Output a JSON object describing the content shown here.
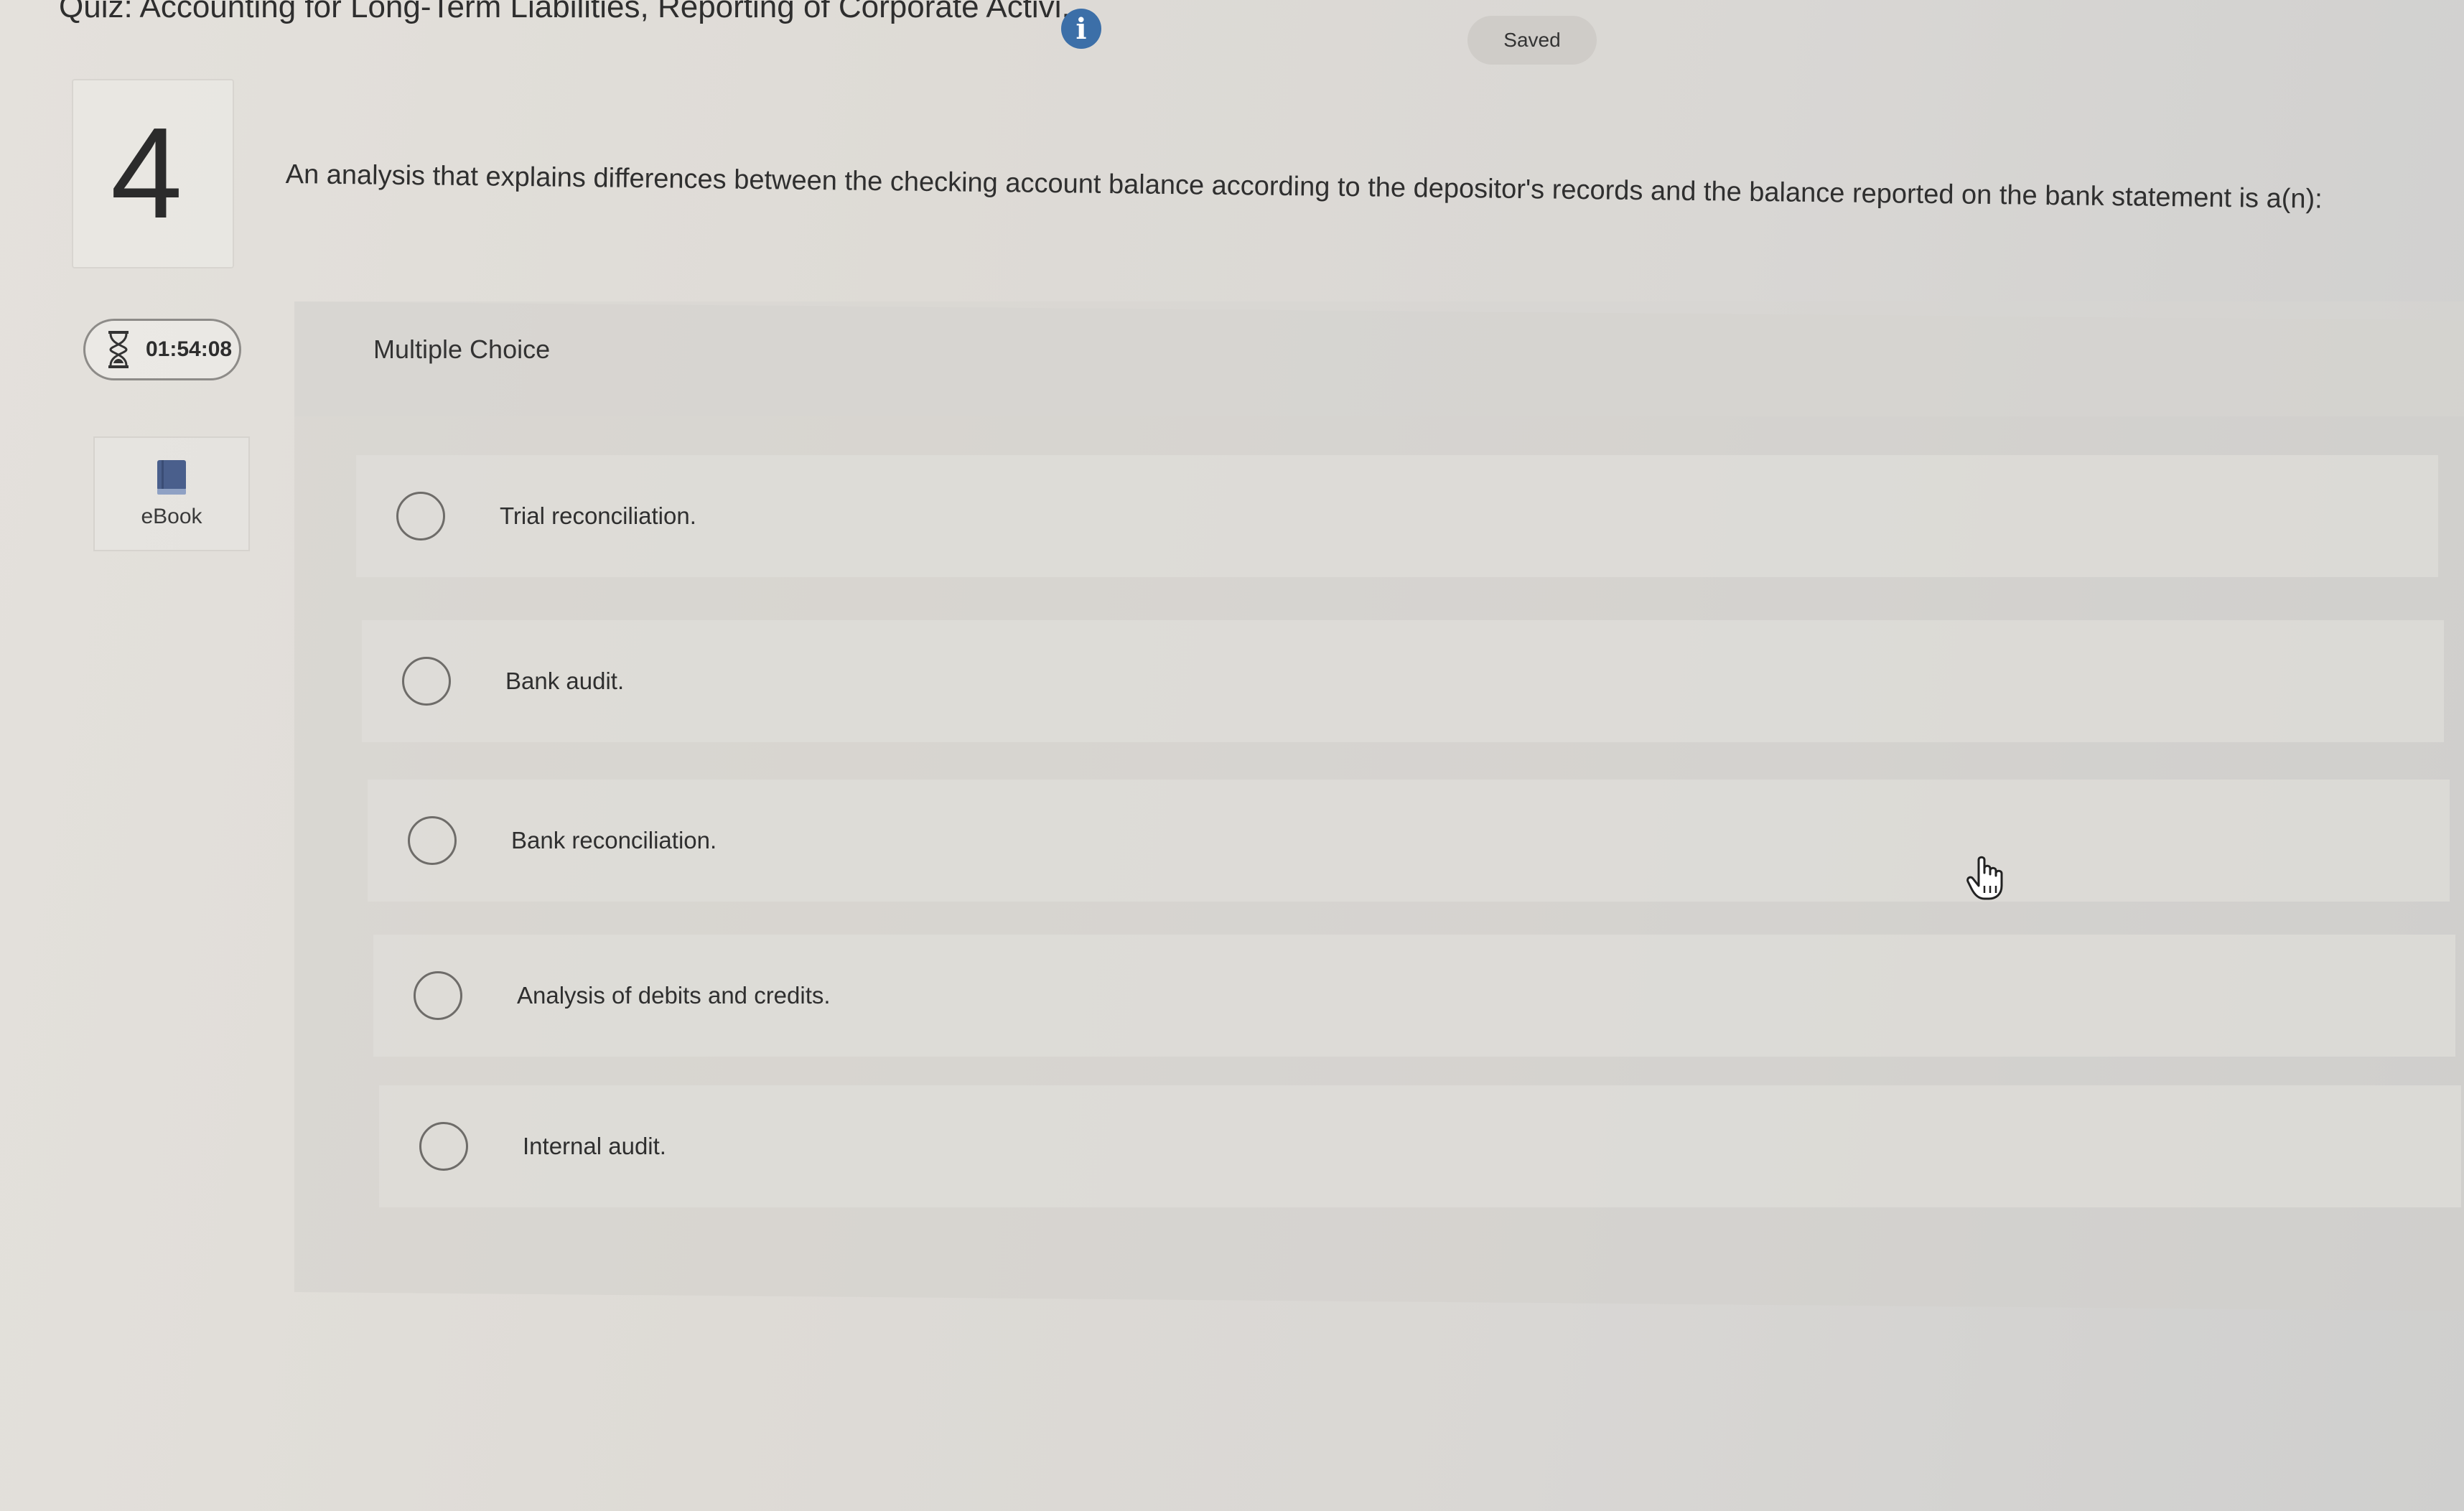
{
  "header": {
    "quiz_title": "Quiz: Accounting for Long-Term Liabilities, Reporting of Corporate Activi...",
    "info_icon": "info-icon",
    "saved_label": "Saved"
  },
  "question": {
    "number": "4",
    "text": "An analysis that explains differences between the checking account balance according to the depositor's records and the balance reported on the bank statement is a(n):"
  },
  "sidebar": {
    "timer": "01:54:08",
    "timer_icon": "hourglass-icon",
    "ebook_label": "eBook",
    "ebook_icon": "book-icon"
  },
  "answer_panel": {
    "type_label": "Multiple Choice",
    "options": [
      {
        "label": "Trial reconciliation."
      },
      {
        "label": "Bank audit."
      },
      {
        "label": "Bank reconciliation."
      },
      {
        "label": "Analysis of debits and credits."
      },
      {
        "label": "Internal audit."
      }
    ]
  },
  "colors": {
    "info_blue": "#3c6fa8",
    "text_dark": "#2f2f2f"
  }
}
